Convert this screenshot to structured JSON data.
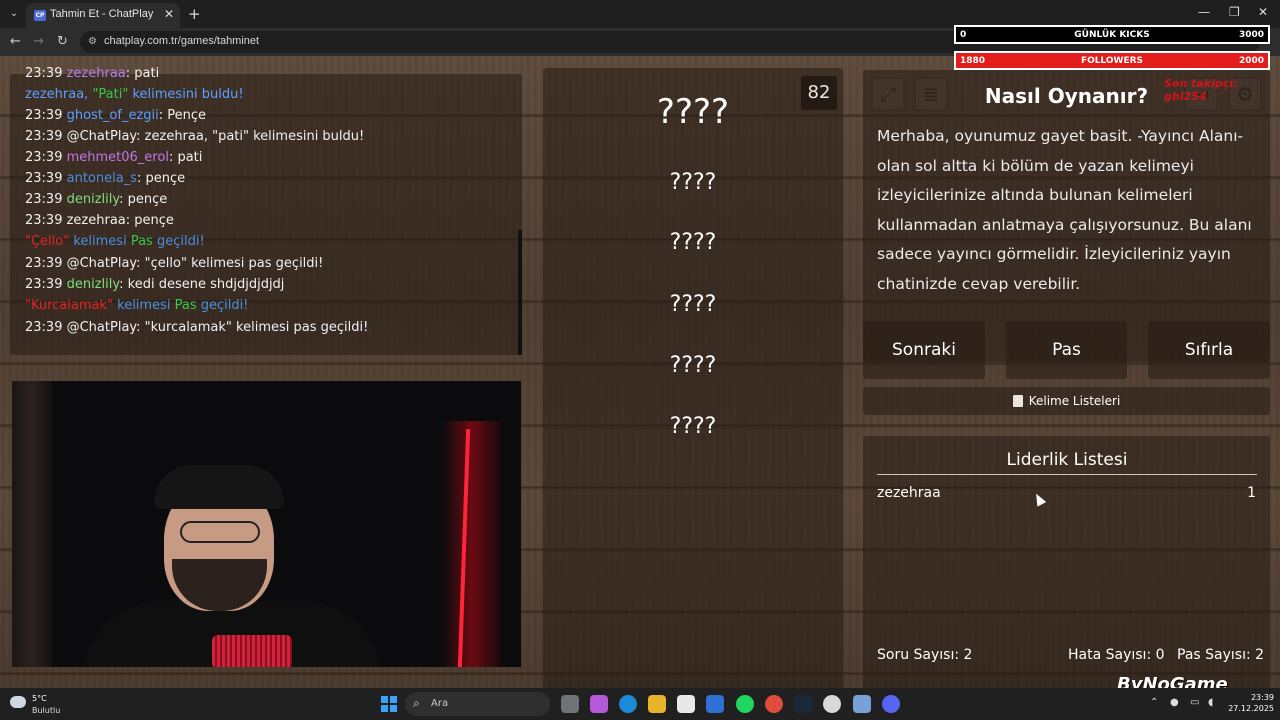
{
  "browser": {
    "tab_title": "Tahmin Et - ChatPlay",
    "tab_favicon": "CP",
    "url": "chatplay.com.tr/games/tahminet"
  },
  "overlay": {
    "kicks": {
      "left": "0",
      "label": "GÜNLÜK KICKS",
      "right": "3000"
    },
    "followers": {
      "left": "1880",
      "label": "FOLLOWERS",
      "right": "2000"
    },
    "red_text": "Son takipçi: gbl254",
    "colors": {
      "followers_bar": "#e31c1c",
      "kicks_bar": "#000000"
    }
  },
  "chat": {
    "lines": [
      {
        "time": "23:39",
        "user": "zezehraa",
        "sep": ": ",
        "msg": "pati",
        "user_color": "#b080e8",
        "msg_color": "#f1f1f1"
      },
      {
        "time": "",
        "user": "zezehraa, ",
        "sep": "",
        "msg": "kelimesini buldu!",
        "quoted": "\"Pati\"",
        "user_color": "#5aa0ff",
        "msg_color": "#5aa0ff",
        "quoted_color": "#36c94a"
      },
      {
        "time": "23:39",
        "user": "ghost_of_ezgii",
        "sep": ": ",
        "msg": "Pençe",
        "user_color": "#5aa0ff",
        "msg_color": "#f1f1f1"
      },
      {
        "time": "23:39",
        "user": "@ChatPlay",
        "sep": ": ",
        "msg": "zezehraa, \"pati\" kelimesini buldu!",
        "user_color": "#f1f1f1",
        "msg_color": "#f1f1f1"
      },
      {
        "time": "23:39",
        "user": "mehmet06_erol",
        "sep": ": ",
        "msg": "pati",
        "user_color": "#c575e8",
        "msg_color": "#f1f1f1"
      },
      {
        "time": "23:39",
        "user": "antonela_s",
        "sep": ": ",
        "msg": "pençe",
        "user_color": "#4a90e0",
        "msg_color": "#f1f1f1"
      },
      {
        "time": "23:39",
        "user": "denizlily",
        "sep": ": ",
        "msg": "pençe",
        "user_color": "#7ee07e",
        "msg_color": "#f1f1f1"
      },
      {
        "time": "23:39",
        "user": "zezehraa",
        "sep": ": ",
        "msg": "pençe",
        "user_color": "#f1f1f1",
        "msg_color": "#f1f1f1"
      },
      {
        "time": "",
        "user": "",
        "sep": "",
        "msg": "",
        "pass_word": "\"Çello\"",
        "pass_mid": " kelimesi ",
        "pass_p": "Pas",
        "pass_end": " geçildi!",
        "system": true
      },
      {
        "time": "23:39",
        "user": "@ChatPlay",
        "sep": ": ",
        "msg": "\"çello\" kelimesi pas geçildi!",
        "user_color": "#f1f1f1",
        "msg_color": "#f1f1f1"
      },
      {
        "time": "23:39",
        "user": "denizlily",
        "sep": ": ",
        "msg": "kedi desene shdjdjdjdjdj",
        "user_color": "#7ee07e",
        "msg_color": "#f1f1f1"
      },
      {
        "time": "",
        "user": "",
        "sep": "",
        "msg": "",
        "pass_word": "\"Kurcalamak\"",
        "pass_mid": " kelimesi ",
        "pass_p": "Pas",
        "pass_end": " geçildi!",
        "system": true
      },
      {
        "time": "23:39",
        "user": "@ChatPlay",
        "sep": ": ",
        "msg": "\"kurcalamak\" kelimesi pas geçildi!",
        "user_color": "#f1f1f1",
        "msg_color": "#f1f1f1"
      }
    ]
  },
  "game": {
    "counter": "82",
    "words": [
      "????",
      "????",
      "????",
      "????",
      "????",
      "????"
    ]
  },
  "howto": {
    "title": "Nasıl Oynanır?",
    "body": "Merhaba, oyunumuz gayet basit. -Yayıncı Alanı- olan sol altta ki bölüm de yazan kelimeyi izleyicilerinize altında bulunan kelimeleri kullanmadan anlatmaya çalışıyorsunuz. Bu alanı sadece yayıncı görmelidir. İzleyicileriniz yayın chatinizde cevap verebilir."
  },
  "controls": {
    "next": "Sonraki",
    "pass": "Pas",
    "reset": "Sıfırla",
    "word_lists": "Kelime Listeleri"
  },
  "leaderboard": {
    "title": "Liderlik Listesi",
    "rows": [
      {
        "name": "zezehraa",
        "score": "1"
      }
    ],
    "question_count_label": "Soru Sayısı: 2",
    "error_count_label": "Hata Sayısı: 0",
    "pass_count_label": "Pas Sayısı: 2"
  },
  "watermark": "ByNoGame",
  "taskbar": {
    "weather_temp": "5°C",
    "weather_desc": "Bulutlu",
    "search_placeholder": "Ara",
    "time": "23:39",
    "date": "27.12.2025"
  }
}
